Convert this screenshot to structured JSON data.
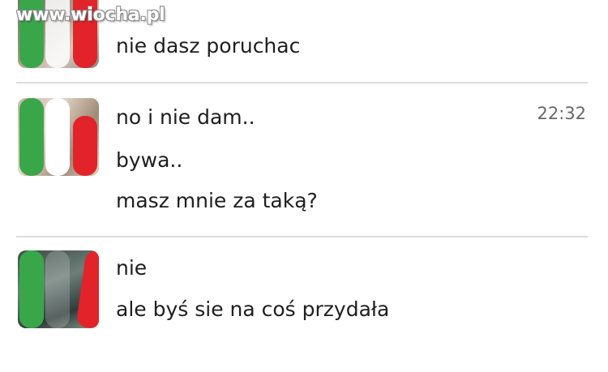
{
  "watermark": {
    "text": "www.wiocha.pl"
  },
  "conversation": {
    "groups": [
      {
        "messages": [
          "nie dasz poruchac"
        ],
        "time": ""
      },
      {
        "messages": [
          "no i nie dam..",
          "bywa..",
          "masz mnie za taką?"
        ],
        "time": "22:32"
      },
      {
        "messages": [
          "nie",
          "ale byś sie na coś przydała"
        ],
        "time": ""
      }
    ]
  },
  "colors": {
    "flag_green": "#3aa64a",
    "flag_white": "#ffffff",
    "flag_red": "#e2232a",
    "divider": "#d8dde3",
    "timestamp": "#666666"
  }
}
